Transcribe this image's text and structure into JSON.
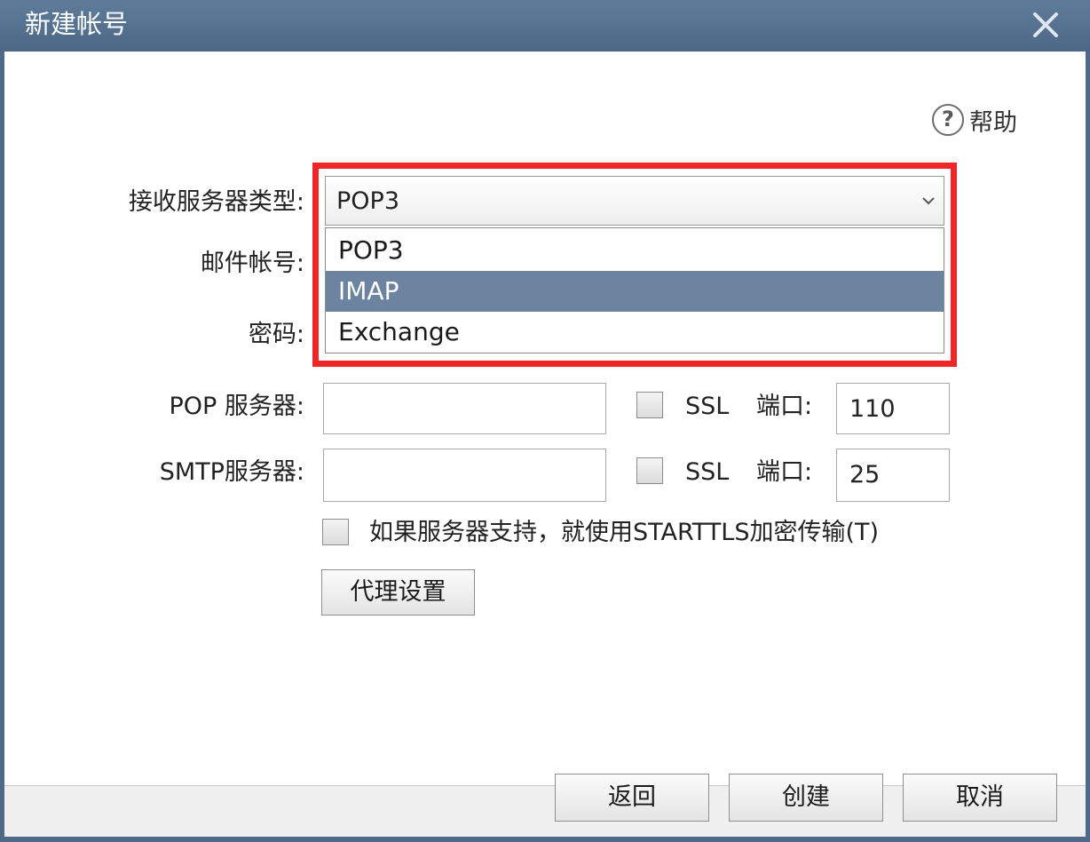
{
  "window": {
    "title": "新建帐号"
  },
  "help": {
    "label": "帮助",
    "icon": "question-circle-icon"
  },
  "form": {
    "server_type_label": "接收服务器类型:",
    "server_type_value": "POP3",
    "account_label": "邮件帐号:",
    "password_label": "密码:",
    "pop_server_label": "POP 服务器:",
    "pop_server_value": "",
    "smtp_server_label": "SMTP服务器:",
    "smtp_server_value": "",
    "ssl_label": "SSL",
    "port_label": "端口:",
    "pop_port_value": "110",
    "smtp_port_value": "25",
    "pop_ssl_checked": false,
    "smtp_ssl_checked": false,
    "starttls_label": "如果服务器支持，就使用STARTTLS加密传输(T)",
    "starttls_checked": false,
    "proxy_button": "代理设置"
  },
  "dropdown": {
    "options": [
      "POP3",
      "IMAP",
      "Exchange"
    ],
    "highlighted": "IMAP"
  },
  "footer": {
    "back_button": "返回",
    "create_button": "创建",
    "cancel_button": "取消"
  },
  "colors": {
    "titlebar": "#5a7595",
    "highlight_border": "#ee2626",
    "option_highlight": "#6c849f"
  }
}
